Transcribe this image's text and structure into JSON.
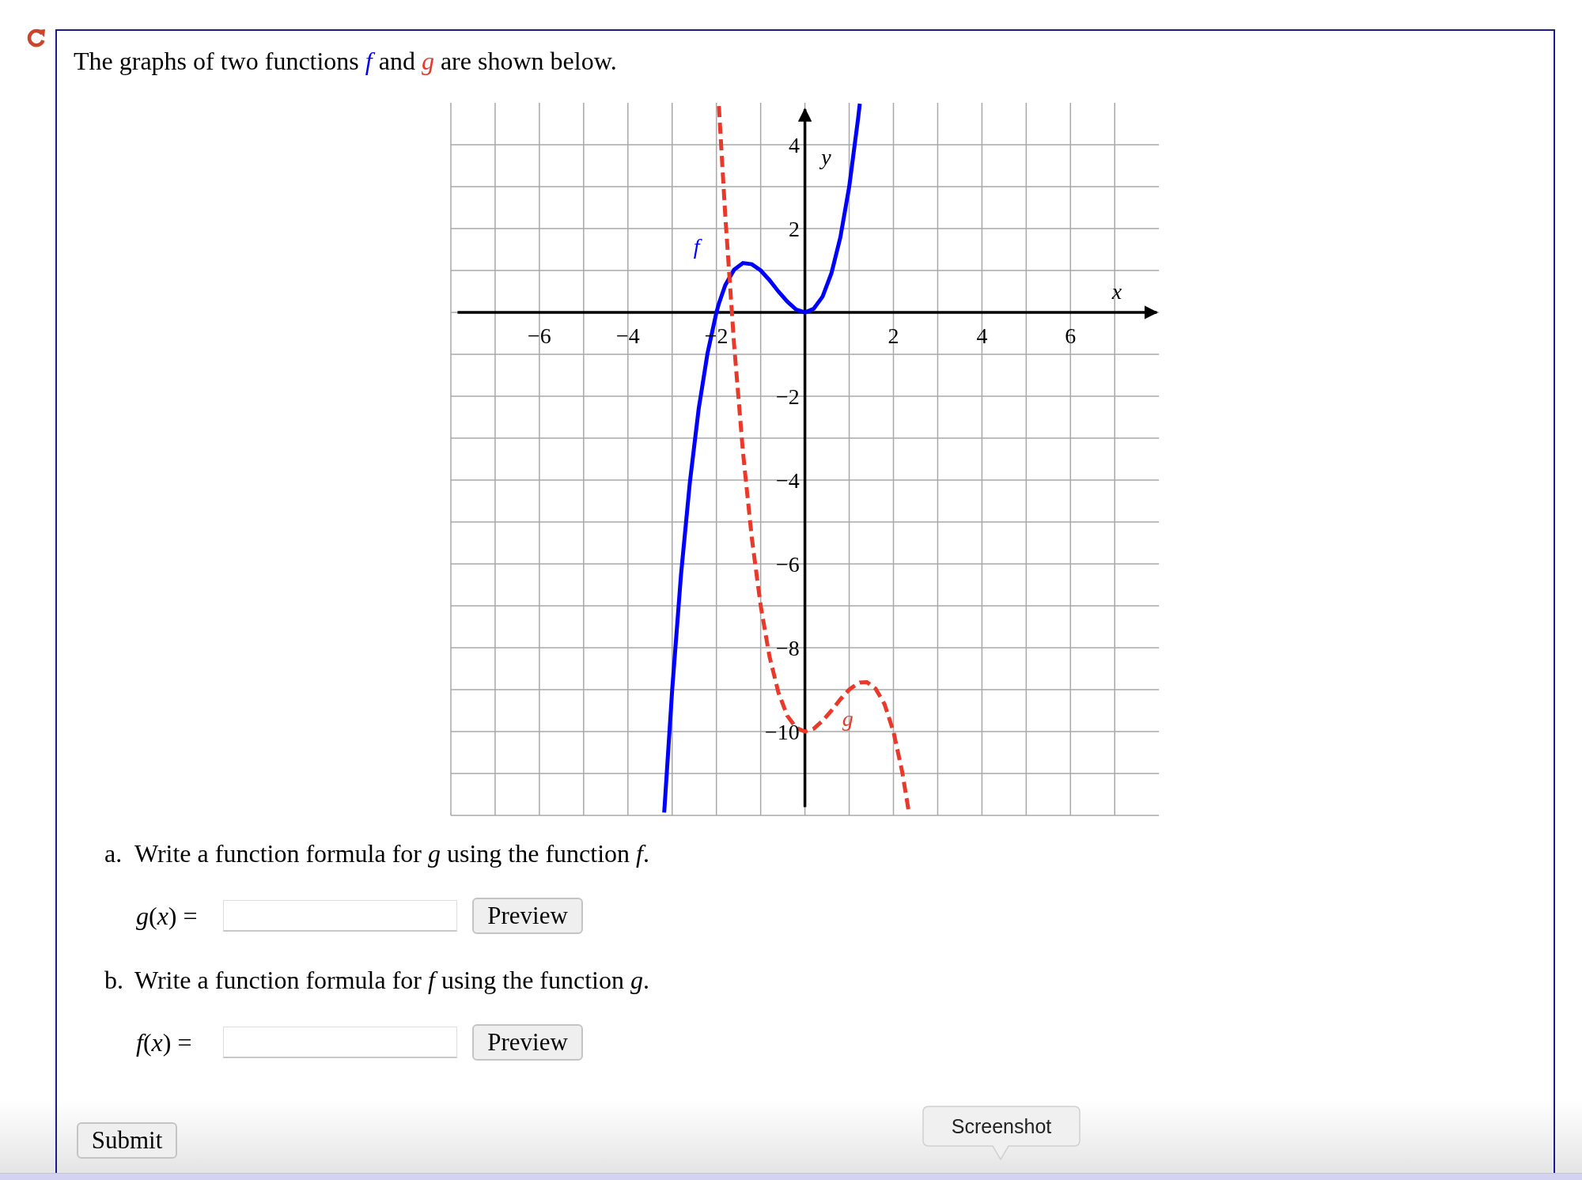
{
  "intro": [
    {
      "text": "The graphs of two functions "
    },
    {
      "text": "*f*",
      "color": "#0000ff"
    },
    {
      "text": " and "
    },
    {
      "text": "*g*",
      "color": "#e8392a"
    },
    {
      "text": " are shown below."
    }
  ],
  "graph": {
    "chart_data": {
      "type": "line",
      "xlabel": "x",
      "ylabel": "y",
      "xlim": [
        -8,
        8
      ],
      "ylim": [
        -12,
        5
      ],
      "grid": true,
      "x": [
        -3.18,
        -3.0,
        -2.8,
        -2.6,
        -2.4,
        -2.2,
        -2.0,
        -1.945,
        -1.8,
        -1.6,
        -1.4,
        -1.2,
        -1.0,
        -0.8,
        -0.6,
        -0.4,
        -0.2,
        0,
        0.2,
        0.4,
        0.6,
        0.8,
        1.0,
        1.2,
        1.24,
        1.4,
        1.6,
        1.8,
        2.0,
        2.2,
        2.355
      ],
      "series": [
        {
          "name": "f",
          "color": "#0000ff",
          "line_style": "solid",
          "values": [
            -11.93,
            -9,
            -6.27,
            -4.06,
            -2.3,
            -0.97,
            0,
            0.21,
            0.65,
            1.02,
            1.18,
            1.15,
            1,
            0.77,
            0.5,
            0.26,
            0.07,
            0,
            0.09,
            0.38,
            0.94,
            1.79,
            3,
            4.61,
            4.98,
            null,
            null,
            null,
            null,
            null,
            null
          ]
        },
        {
          "name": "g",
          "color": "#e8392a",
          "line_style": "dashed",
          "values": [
            null,
            null,
            null,
            null,
            null,
            null,
            null,
            4.92,
            2.31,
            -0.78,
            -3.34,
            -5.39,
            -7,
            -8.21,
            -9.06,
            -9.62,
            -9.91,
            -10,
            -9.93,
            -9.74,
            -9.5,
            -9.23,
            -9,
            -8.85,
            -8.83,
            -8.82,
            -8.98,
            -9.35,
            -10,
            -10.97,
            -11.97
          ]
        }
      ],
      "xticks": [
        {
          "value": -6,
          "label": "−6"
        },
        {
          "value": -4,
          "label": "−4"
        },
        {
          "value": -2,
          "label": "−2"
        },
        {
          "value": 2,
          "label": "2"
        },
        {
          "value": 4,
          "label": "4"
        },
        {
          "value": 6,
          "label": "6"
        }
      ],
      "yticks": [
        {
          "value": 4,
          "label": "4"
        },
        {
          "value": 2,
          "label": "2"
        },
        {
          "value": -2,
          "label": "−2"
        },
        {
          "value": -4,
          "label": "−4"
        },
        {
          "value": -6,
          "label": "−6"
        },
        {
          "value": -8,
          "label": "−8"
        },
        {
          "value": -10,
          "label": "−10"
        }
      ]
    }
  },
  "questions": [
    {
      "marker": "a.",
      "text": "Write a function formula for *g* using the function *f*.",
      "label": "*g*(*x*) =",
      "button": "Preview"
    },
    {
      "marker": "b.",
      "text": "Write a function formula for *f* using the function *g*.",
      "label": "*f*(*x*) =",
      "button": "Preview"
    }
  ],
  "submit": "Submit",
  "tooltip": "Screenshot"
}
